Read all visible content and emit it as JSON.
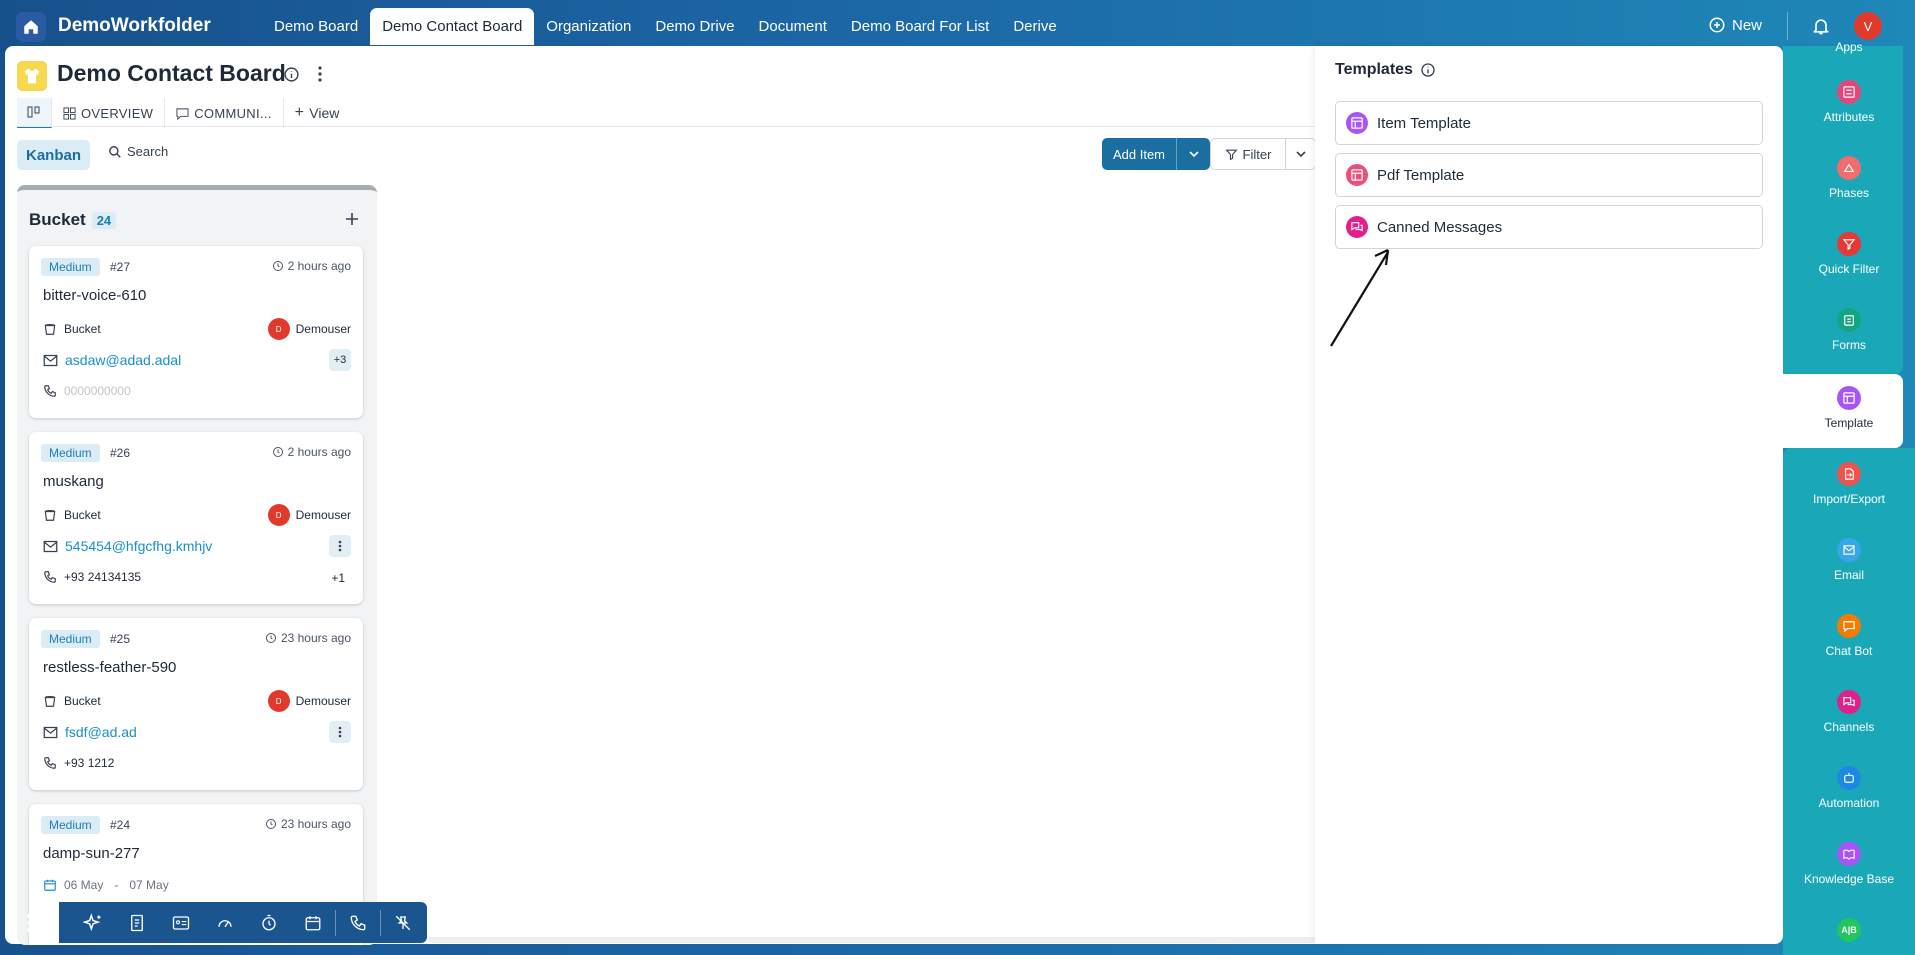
{
  "app": {
    "name": "DemoWorkfolder"
  },
  "topnav": {
    "tabs": [
      "Demo Board",
      "Demo Contact Board",
      "Organization",
      "Demo Drive",
      "Document",
      "Demo Board For List",
      "Derive"
    ],
    "active_index": 1
  },
  "header": {
    "new_label": "New",
    "user_initial": "V"
  },
  "board": {
    "title": "Demo Contact Board",
    "view_tabs": {
      "overview": "OVERVIEW",
      "communication": "COMMUNI...",
      "add_view": "View"
    },
    "toolbar": {
      "kanban": "Kanban",
      "search": "Search",
      "add_item": "Add Item",
      "filter": "Filter"
    },
    "column": {
      "title": "Bucket",
      "count": "24",
      "cards": [
        {
          "priority": "Medium",
          "number": "#27",
          "time": "2 hours ago",
          "name": "bitter-voice-610",
          "bucket": "Bucket",
          "owner": "Demouser",
          "owner_initial": "D",
          "email": "asdaw@adad.adal",
          "email_badge": "+3",
          "phone": "0000000000"
        },
        {
          "priority": "Medium",
          "number": "#26",
          "time": "2 hours ago",
          "name": "muskang",
          "bucket": "Bucket",
          "owner": "Demouser",
          "owner_initial": "D",
          "email": "545454@hfgcfhg.kmhjv",
          "phone": "+93 24134135",
          "phone_badge": "+1"
        },
        {
          "priority": "Medium",
          "number": "#25",
          "time": "23 hours ago",
          "name": "restless-feather-590",
          "bucket": "Bucket",
          "owner": "Demouser",
          "owner_initial": "D",
          "email": "fsdf@ad.ad",
          "phone": "+93 1212"
        },
        {
          "priority": "Medium",
          "number": "#24",
          "time": "23 hours ago",
          "name": "damp-sun-277",
          "date_start": "06 May",
          "date_sep": "-",
          "date_end": "07 May"
        }
      ]
    }
  },
  "templates_panel": {
    "title": "Templates",
    "items": [
      {
        "label": "Item Template",
        "icon": "item-template-icon",
        "color": "#a855f7"
      },
      {
        "label": "Pdf Template",
        "icon": "pdf-template-icon",
        "color": "#ec4f7a"
      },
      {
        "label": "Canned Messages",
        "icon": "canned-messages-icon",
        "color": "#e0218a"
      }
    ]
  },
  "right_sidebar": {
    "items": [
      {
        "label": "Apps"
      },
      {
        "label": "Attributes",
        "color": "#e5467a"
      },
      {
        "label": "Phases",
        "color": "#f16d6d"
      },
      {
        "label": "Quick Filter",
        "color": "#e53935"
      },
      {
        "label": "Forms",
        "color": "#16a37f"
      },
      {
        "label": "Template",
        "color": "#a855f7"
      },
      {
        "label": "Import/Export",
        "color": "#ef5350"
      },
      {
        "label": "Email",
        "color": "#38a6e8"
      },
      {
        "label": "Chat Bot",
        "color": "#f57c00"
      },
      {
        "label": "Channels",
        "color": "#e0218a"
      },
      {
        "label": "Automation",
        "color": "#1e88e5"
      },
      {
        "label": "Knowledge Base",
        "color": "#a855f7"
      },
      {
        "label": "A|B",
        "color": "#22c55e"
      }
    ],
    "active": "Template"
  },
  "colors": {
    "accent": "#1a6fa0",
    "priority_bg": "#dcecf7",
    "owner_avatar": "#e1392b",
    "sidebar_bg": "#1aa8b8"
  }
}
